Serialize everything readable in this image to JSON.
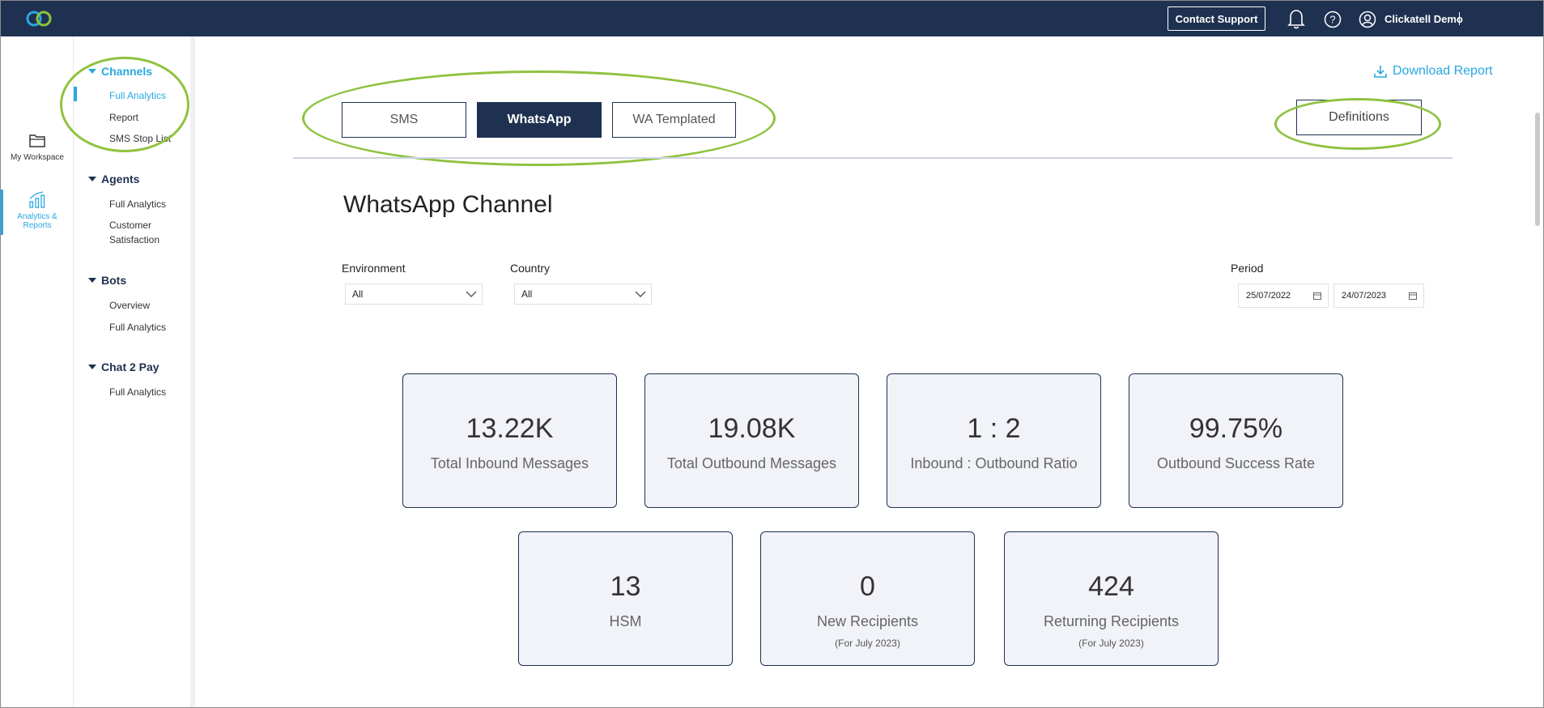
{
  "header": {
    "contact_label": "Contact Support",
    "user_name": "Clickatell Demo",
    "brand_color": "#1f3150",
    "accent_color": "#29a8e0"
  },
  "rail": {
    "items": [
      {
        "label": "My Workspace",
        "icon": "folder-icon"
      },
      {
        "label": "Analytics &",
        "label2": "Reports",
        "icon": "analytics-icon"
      }
    ]
  },
  "nav": {
    "groups": [
      {
        "label": "Channels",
        "items": [
          "Full Analytics",
          "Report",
          "SMS Stop List"
        ]
      },
      {
        "label": "Agents",
        "items": [
          "Full Analytics",
          "Customer",
          "Satisfaction"
        ]
      },
      {
        "label": "Bots",
        "items": [
          "Overview",
          "Full Analytics"
        ]
      },
      {
        "label": "Chat 2 Pay",
        "items": [
          "Full Analytics"
        ]
      }
    ]
  },
  "main": {
    "download_label": "Download Report",
    "tabs": [
      {
        "label": "SMS"
      },
      {
        "label": "WhatsApp"
      },
      {
        "label": "WA Templated"
      }
    ],
    "definitions_label": "Definitions",
    "title": "WhatsApp Channel",
    "filters": {
      "environment_label": "Environment",
      "environment_value": "All",
      "country_label": "Country",
      "country_value": "All",
      "period_label": "Period",
      "date_from": "25/07/2022",
      "date_to": "24/07/2023"
    },
    "cards": [
      {
        "value": "13.22K",
        "label": "Total Inbound Messages",
        "sub": ""
      },
      {
        "value": "19.08K",
        "label": "Total Outbound Messages",
        "sub": ""
      },
      {
        "value": "1 : 2",
        "label": "Inbound : Outbound Ratio",
        "sub": ""
      },
      {
        "value": "99.75%",
        "label": "Outbound Success Rate",
        "sub": ""
      },
      {
        "value": "13",
        "label": "HSM",
        "sub": ""
      },
      {
        "value": "0",
        "label": "New Recipients",
        "sub": "(For July 2023)"
      },
      {
        "value": "424",
        "label": "Returning Recipients",
        "sub": "(For July 2023)"
      }
    ]
  }
}
